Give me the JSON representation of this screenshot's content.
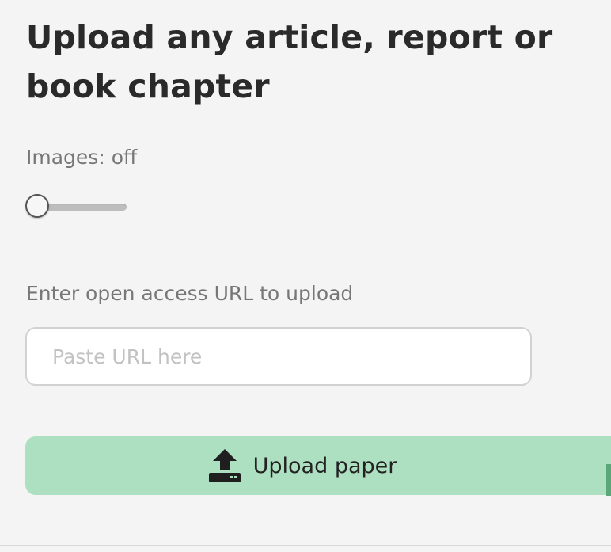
{
  "form": {
    "title": "Upload any article, report or book chapter",
    "images_label": "Images: off",
    "images_enabled": false,
    "url_label": "Enter open access URL to upload",
    "url_input": {
      "value": "",
      "placeholder": "Paste URL here"
    },
    "upload_button": {
      "label": "Upload paper",
      "icon": "upload-icon"
    }
  },
  "colors": {
    "background": "#f4f4f4",
    "button_background": "#addfc1",
    "title_text": "#2a2a2a",
    "label_text": "#777777"
  }
}
